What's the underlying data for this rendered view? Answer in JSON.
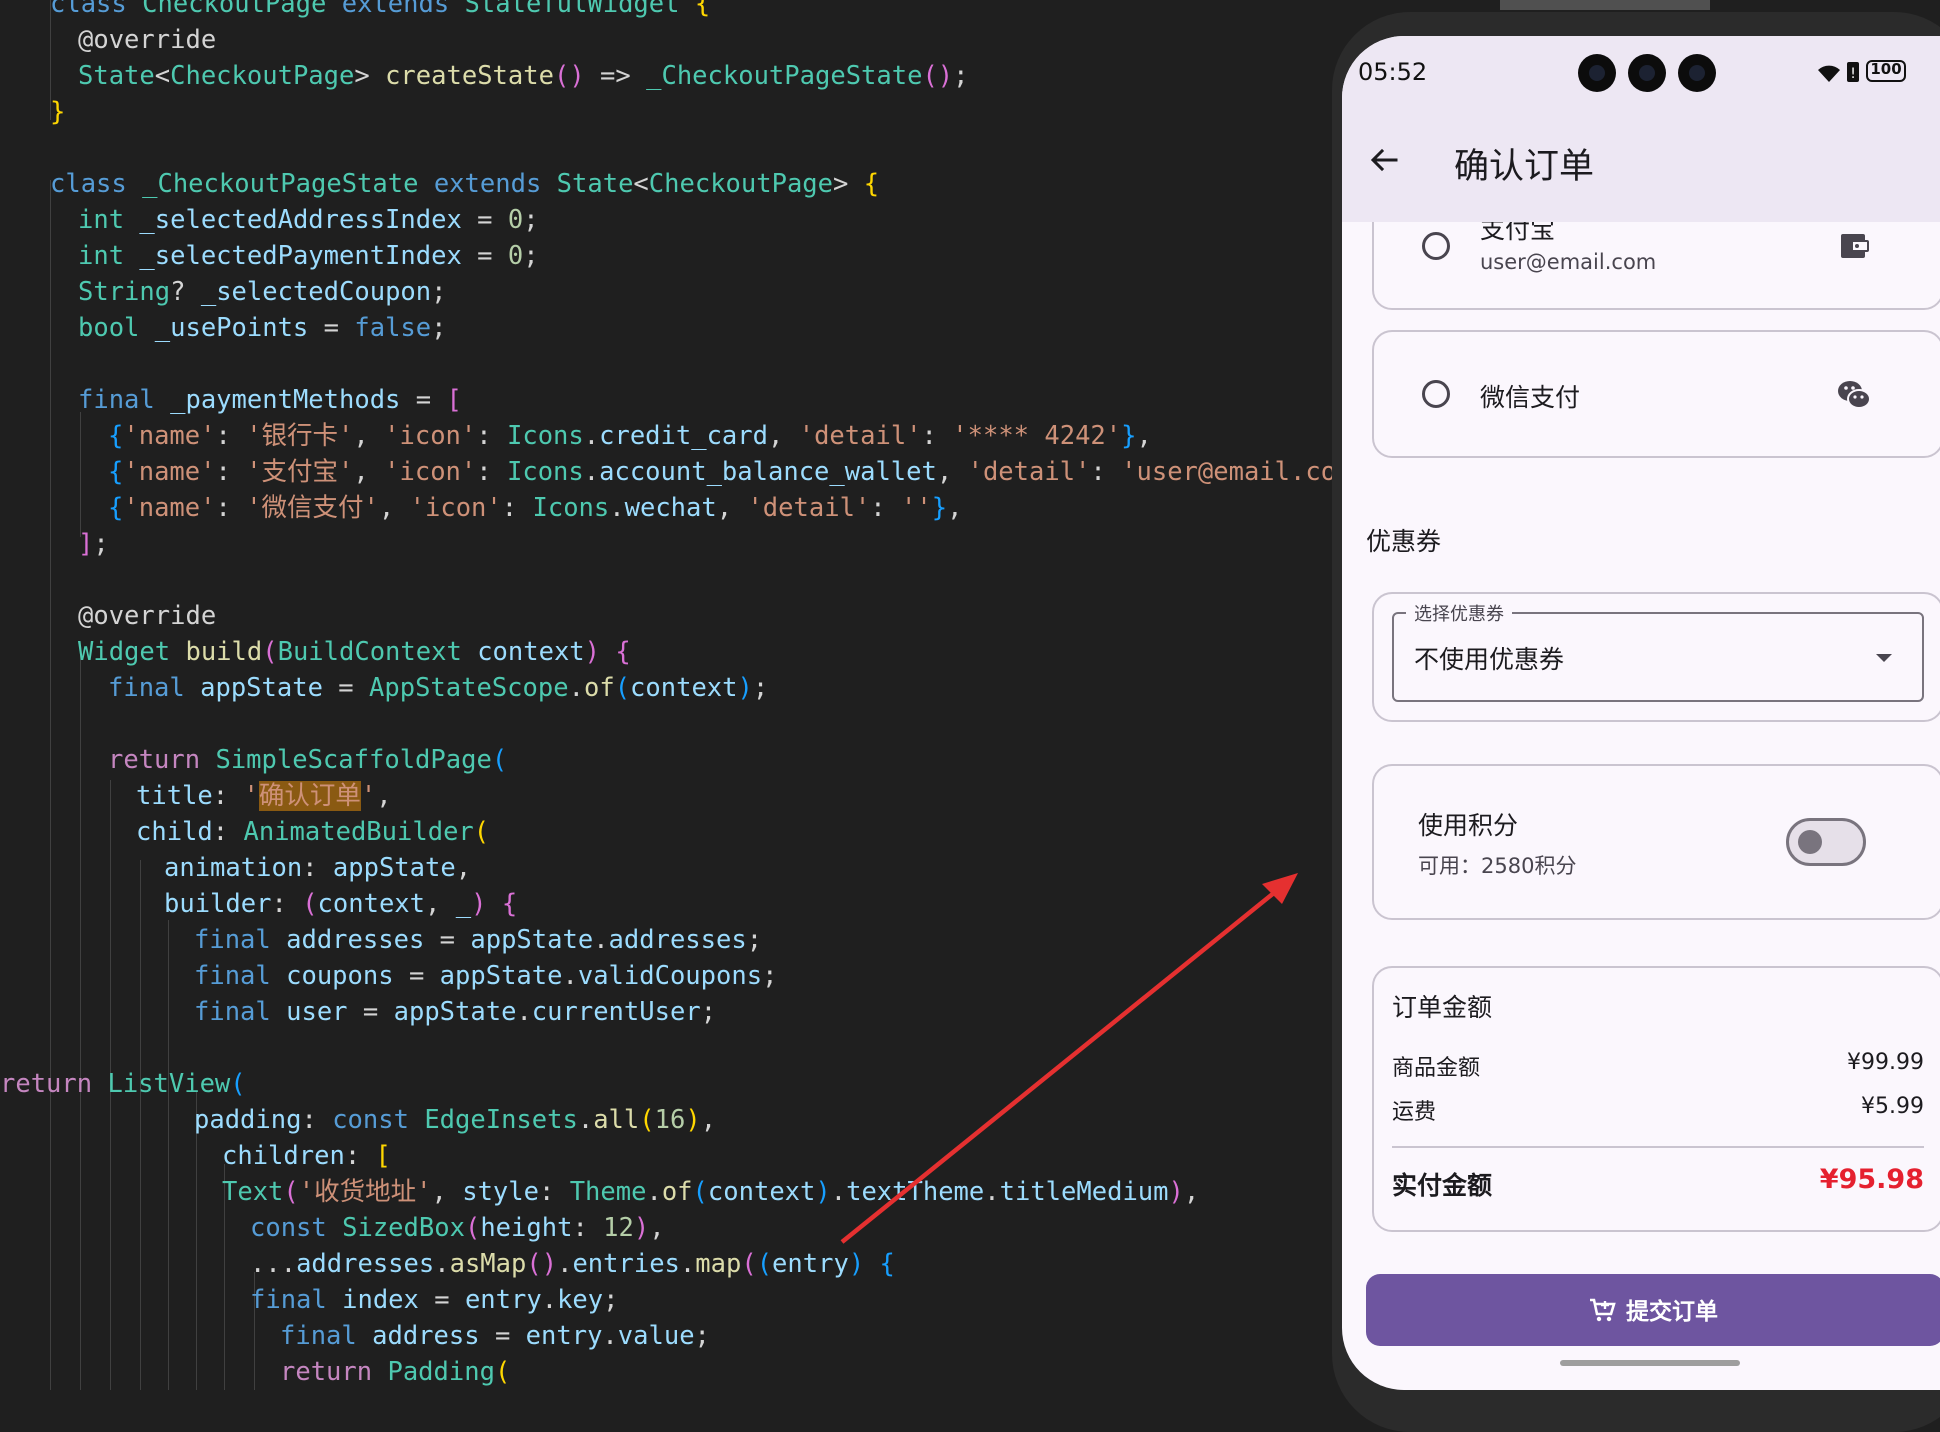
{
  "editor": {
    "lines": [
      [
        [
          "kw",
          "class "
        ],
        [
          "type",
          "CheckoutPage "
        ],
        [
          "kw",
          "extends "
        ],
        [
          "type",
          "StatefulWidget "
        ],
        [
          "b1",
          "{"
        ]
      ],
      [
        [
          "plain",
          "@override"
        ]
      ],
      [
        [
          "type",
          "State"
        ],
        [
          "plain",
          "<"
        ],
        [
          "type",
          "CheckoutPage"
        ],
        [
          "plain",
          "> "
        ],
        [
          "fn",
          "createState"
        ],
        [
          "b2",
          "()"
        ],
        [
          "plain",
          " => "
        ],
        [
          "type",
          "_CheckoutPageState"
        ],
        [
          "b2",
          "()"
        ],
        [
          "plain",
          ";"
        ]
      ],
      [
        [
          "b1",
          "}"
        ]
      ],
      [],
      [
        [
          "kw",
          "class "
        ],
        [
          "type",
          "_CheckoutPageState "
        ],
        [
          "kw",
          "extends "
        ],
        [
          "type",
          "State"
        ],
        [
          "plain",
          "<"
        ],
        [
          "type",
          "CheckoutPage"
        ],
        [
          "plain",
          "> "
        ],
        [
          "b1",
          "{"
        ]
      ],
      [
        [
          "type",
          "int "
        ],
        [
          "var",
          "_selectedAddressIndex"
        ],
        [
          "plain",
          " = "
        ],
        [
          "num",
          "0"
        ],
        [
          "plain",
          ";"
        ]
      ],
      [
        [
          "type",
          "int "
        ],
        [
          "var",
          "_selectedPaymentIndex"
        ],
        [
          "plain",
          " = "
        ],
        [
          "num",
          "0"
        ],
        [
          "plain",
          ";"
        ]
      ],
      [
        [
          "type",
          "String"
        ],
        [
          "plain",
          "? "
        ],
        [
          "var",
          "_selectedCoupon"
        ],
        [
          "plain",
          ";"
        ]
      ],
      [
        [
          "type",
          "bool "
        ],
        [
          "var",
          "_usePoints"
        ],
        [
          "plain",
          " = "
        ],
        [
          "kw",
          "false"
        ],
        [
          "plain",
          ";"
        ]
      ],
      [],
      [
        [
          "kw",
          "final "
        ],
        [
          "var",
          "_paymentMethods"
        ],
        [
          "plain",
          " = "
        ],
        [
          "b2",
          "["
        ]
      ],
      [
        [
          "b3",
          "{"
        ],
        [
          "str",
          "'name'"
        ],
        [
          "plain",
          ": "
        ],
        [
          "str",
          "'银行卡'"
        ],
        [
          "plain",
          ", "
        ],
        [
          "str",
          "'icon'"
        ],
        [
          "plain",
          ": "
        ],
        [
          "type",
          "Icons"
        ],
        [
          "plain",
          "."
        ],
        [
          "var",
          "credit_card"
        ],
        [
          "plain",
          ", "
        ],
        [
          "str",
          "'detail'"
        ],
        [
          "plain",
          ": "
        ],
        [
          "str",
          "'**** 4242'"
        ],
        [
          "b3",
          "}"
        ],
        [
          "plain",
          ","
        ]
      ],
      [
        [
          "b3",
          "{"
        ],
        [
          "str",
          "'name'"
        ],
        [
          "plain",
          ": "
        ],
        [
          "str",
          "'支付宝'"
        ],
        [
          "plain",
          ", "
        ],
        [
          "str",
          "'icon'"
        ],
        [
          "plain",
          ": "
        ],
        [
          "type",
          "Icons"
        ],
        [
          "plain",
          "."
        ],
        [
          "var",
          "account_balance_wallet"
        ],
        [
          "plain",
          ", "
        ],
        [
          "str",
          "'detail'"
        ],
        [
          "plain",
          ": "
        ],
        [
          "str",
          "'user@email.com'"
        ],
        [
          "b3",
          "}"
        ],
        [
          "plain",
          ","
        ]
      ],
      [
        [
          "b3",
          "{"
        ],
        [
          "str",
          "'name'"
        ],
        [
          "plain",
          ": "
        ],
        [
          "str",
          "'微信支付'"
        ],
        [
          "plain",
          ", "
        ],
        [
          "str",
          "'icon'"
        ],
        [
          "plain",
          ": "
        ],
        [
          "type",
          "Icons"
        ],
        [
          "plain",
          "."
        ],
        [
          "var",
          "wechat"
        ],
        [
          "plain",
          ", "
        ],
        [
          "str",
          "'detail'"
        ],
        [
          "plain",
          ": "
        ],
        [
          "str",
          "''"
        ],
        [
          "b3",
          "}"
        ],
        [
          "plain",
          ","
        ]
      ],
      [
        [
          "b2",
          "]"
        ],
        [
          "plain",
          ";"
        ]
      ],
      [],
      [
        [
          "plain",
          "@override"
        ]
      ],
      [
        [
          "type",
          "Widget "
        ],
        [
          "fn",
          "build"
        ],
        [
          "b2",
          "("
        ],
        [
          "type",
          "BuildContext "
        ],
        [
          "var",
          "context"
        ],
        [
          "b2",
          ")"
        ],
        [
          "plain",
          " "
        ],
        [
          "b2",
          "{"
        ]
      ],
      [
        [
          "kw",
          "final "
        ],
        [
          "var",
          "appState"
        ],
        [
          "plain",
          " = "
        ],
        [
          "type",
          "AppStateScope"
        ],
        [
          "plain",
          "."
        ],
        [
          "fn",
          "of"
        ],
        [
          "b3",
          "("
        ],
        [
          "var",
          "context"
        ],
        [
          "b3",
          ")"
        ],
        [
          "plain",
          ";"
        ]
      ],
      [],
      [
        [
          "ctl",
          "return "
        ],
        [
          "type",
          "SimpleScaffoldPage"
        ],
        [
          "b3",
          "("
        ]
      ],
      [
        [
          "var",
          "title"
        ],
        [
          "plain",
          ": "
        ],
        [
          "str",
          "'"
        ],
        [
          "hl",
          "确认订单"
        ],
        [
          "str",
          "'"
        ],
        [
          "plain",
          ","
        ]
      ],
      [
        [
          "var",
          "child"
        ],
        [
          "plain",
          ": "
        ],
        [
          "type",
          "AnimatedBuilder"
        ],
        [
          "b1",
          "("
        ]
      ],
      [
        [
          "var",
          "animation"
        ],
        [
          "plain",
          ": "
        ],
        [
          "var",
          "appState"
        ],
        [
          "plain",
          ","
        ]
      ],
      [
        [
          "var",
          "builder"
        ],
        [
          "plain",
          ": "
        ],
        [
          "b2",
          "("
        ],
        [
          "var",
          "context"
        ],
        [
          "plain",
          ", "
        ],
        [
          "var",
          "_"
        ],
        [
          "b2",
          ")"
        ],
        [
          "plain",
          " "
        ],
        [
          "b2",
          "{"
        ]
      ],
      [
        [
          "kw",
          "final "
        ],
        [
          "var",
          "addresses"
        ],
        [
          "plain",
          " = "
        ],
        [
          "var",
          "appState"
        ],
        [
          "plain",
          "."
        ],
        [
          "var",
          "addresses"
        ],
        [
          "plain",
          ";"
        ]
      ],
      [
        [
          "kw",
          "final "
        ],
        [
          "var",
          "coupons"
        ],
        [
          "plain",
          " = "
        ],
        [
          "var",
          "appState"
        ],
        [
          "plain",
          "."
        ],
        [
          "var",
          "validCoupons"
        ],
        [
          "plain",
          ";"
        ]
      ],
      [
        [
          "kw",
          "final "
        ],
        [
          "var",
          "user"
        ],
        [
          "plain",
          " = "
        ],
        [
          "var",
          "appState"
        ],
        [
          "plain",
          "."
        ],
        [
          "var",
          "currentUser"
        ],
        [
          "plain",
          ";"
        ]
      ],
      [],
      [
        [
          "ctl",
          "return "
        ],
        [
          "type",
          "ListView"
        ],
        [
          "b3",
          "("
        ]
      ],
      [
        [
          "var",
          "padding"
        ],
        [
          "plain",
          ": "
        ],
        [
          "kw",
          "const "
        ],
        [
          "type",
          "EdgeInsets"
        ],
        [
          "plain",
          "."
        ],
        [
          "fn",
          "all"
        ],
        [
          "b1",
          "("
        ],
        [
          "num",
          "16"
        ],
        [
          "b1",
          ")"
        ],
        [
          "plain",
          ","
        ]
      ],
      [
        [
          "var",
          "children"
        ],
        [
          "plain",
          ": "
        ],
        [
          "b1",
          "["
        ]
      ],
      [
        [
          "type",
          "Text"
        ],
        [
          "b2",
          "("
        ],
        [
          "str",
          "'收货地址'"
        ],
        [
          "plain",
          ", "
        ],
        [
          "var",
          "style"
        ],
        [
          "plain",
          ": "
        ],
        [
          "type",
          "Theme"
        ],
        [
          "plain",
          "."
        ],
        [
          "fn",
          "of"
        ],
        [
          "b3",
          "("
        ],
        [
          "var",
          "context"
        ],
        [
          "b3",
          ")"
        ],
        [
          "plain",
          "."
        ],
        [
          "var",
          "textTheme"
        ],
        [
          "plain",
          "."
        ],
        [
          "var",
          "titleMedium"
        ],
        [
          "b2",
          ")"
        ],
        [
          "plain",
          ","
        ]
      ],
      [
        [
          "kw",
          "const "
        ],
        [
          "type",
          "SizedBox"
        ],
        [
          "b2",
          "("
        ],
        [
          "var",
          "height"
        ],
        [
          "plain",
          ": "
        ],
        [
          "num",
          "12"
        ],
        [
          "b2",
          ")"
        ],
        [
          "plain",
          ","
        ]
      ],
      [
        [
          "plain",
          "..."
        ],
        [
          "var",
          "addresses"
        ],
        [
          "plain",
          "."
        ],
        [
          "fn",
          "asMap"
        ],
        [
          "b2",
          "()"
        ],
        [
          "plain",
          "."
        ],
        [
          "var",
          "entries"
        ],
        [
          "plain",
          "."
        ],
        [
          "fn",
          "map"
        ],
        [
          "b2",
          "("
        ],
        [
          "b3",
          "("
        ],
        [
          "var",
          "entry"
        ],
        [
          "b3",
          ")"
        ],
        [
          "plain",
          " "
        ],
        [
          "b3",
          "{"
        ]
      ],
      [
        [
          "kw",
          "final "
        ],
        [
          "var",
          "index"
        ],
        [
          "plain",
          " = "
        ],
        [
          "var",
          "entry"
        ],
        [
          "plain",
          "."
        ],
        [
          "var",
          "key"
        ],
        [
          "plain",
          ";"
        ]
      ],
      [
        [
          "kw",
          "final "
        ],
        [
          "var",
          "address"
        ],
        [
          "plain",
          " = "
        ],
        [
          "var",
          "entry"
        ],
        [
          "plain",
          "."
        ],
        [
          "var",
          "value"
        ],
        [
          "plain",
          ";"
        ]
      ],
      [
        [
          "ctl",
          "return "
        ],
        [
          "type",
          "Padding"
        ],
        [
          "b1",
          "("
        ]
      ]
    ]
  },
  "phone": {
    "status": {
      "time": "05:52",
      "battery": "100"
    },
    "app_bar": {
      "title": "确认订单"
    },
    "payment": [
      {
        "name": "支付宝",
        "detail": "user@email.com",
        "icon": "account-balance-wallet-icon"
      },
      {
        "name": "微信支付",
        "detail": "",
        "icon": "wechat-icon"
      }
    ],
    "coupon": {
      "section_title": "优惠券",
      "field_label": "选择优惠券",
      "selected": "不使用优惠券"
    },
    "points": {
      "label": "使用积分",
      "available": "可用：2580积分",
      "enabled": false
    },
    "summary": {
      "title": "订单金额",
      "rows": [
        {
          "label": "商品金额",
          "value": "¥99.99"
        },
        {
          "label": "运费",
          "value": "¥5.99"
        }
      ],
      "total_label": "实付金额",
      "total_value": "¥95.98"
    },
    "submit_label": "提交订单"
  },
  "colors": {
    "editor_bg": "#1f1f1f",
    "app_bar_bg": "#ede7f3",
    "primary": "#6e55a0",
    "price_red": "#e5202f",
    "arrow_red": "#e53030"
  }
}
